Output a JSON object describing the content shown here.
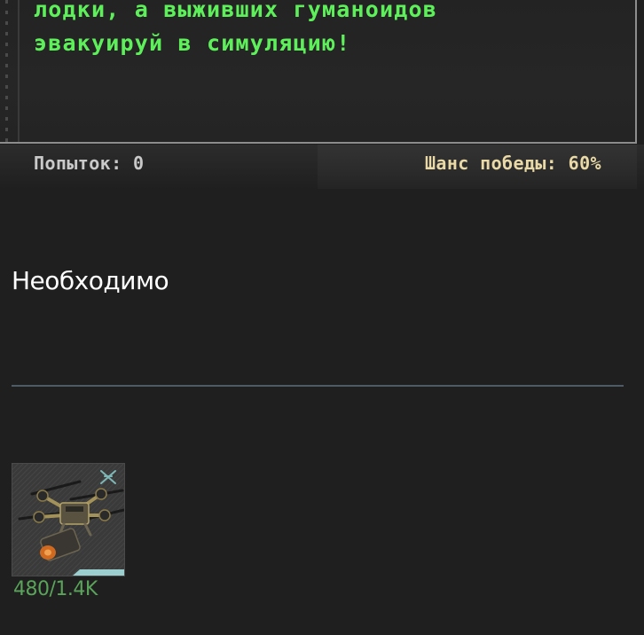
{
  "mission": {
    "lines": [
      "лодки, а выживших гуманоидов",
      "эвакуируй в симуляцию!"
    ]
  },
  "stats": {
    "attempts": "Попыток: 0",
    "win_chance": "Шанс победы: 60%"
  },
  "requirements": {
    "title": "Необходимо",
    "items": [
      {
        "icon": "drone-icon",
        "count": "480/1.4K"
      }
    ]
  },
  "colors": {
    "mission_text": "#5ef05a",
    "win_chance": "#e9d9a6",
    "item_count": "#5aa35a",
    "rarity": "#9bcfcf"
  }
}
